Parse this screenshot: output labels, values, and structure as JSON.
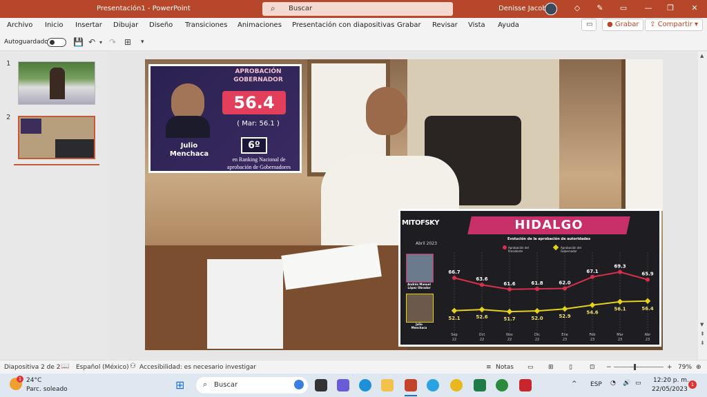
{
  "window": {
    "title": "Presentación1  -  PowerPoint",
    "search_placeholder": "Buscar",
    "user": "Denisse Jacobo"
  },
  "menu": [
    "Archivo",
    "Inicio",
    "Insertar",
    "Dibujar",
    "Diseño",
    "Transiciones",
    "Animaciones",
    "Presentación con diapositivas",
    "Grabar",
    "Revisar",
    "Vista",
    "Ayuda"
  ],
  "ribbon": {
    "record": "Grabar",
    "share": "Compartir"
  },
  "qat": {
    "autosave": "Autoguardado"
  },
  "thumbs": [
    "1",
    "2"
  ],
  "slide": {
    "card": {
      "heading_line1": "APROBACIÓN",
      "heading_line2": "GOBERNADOR",
      "value": "56.4",
      "previous": "( Mar: 56.1 )",
      "name_line1": "Julio",
      "name_line2": "Menchaca",
      "rank": "6º",
      "rank_text_line1": "en Ranking Nacional de",
      "rank_text_line2": "aprobación de Gobernadores"
    },
    "chart_card": {
      "brand": "MITOFSKY",
      "month": "Abril 2023",
      "title": "HIDALGO",
      "subtitle": "Evolución de la aprobación de autoridades",
      "legend1": "Aprobación del Presidente",
      "legend2": "Aprobación del Gobernador",
      "person1_line1": "Andrés Manuel",
      "person1_line2": "López Obrador",
      "person2_line1": "Julio",
      "person2_line2": "Menchaca"
    }
  },
  "chart_data": {
    "type": "line",
    "categories": [
      [
        "Sep",
        "22"
      ],
      [
        "Oct",
        "22"
      ],
      [
        "Nov",
        "22"
      ],
      [
        "Dic",
        "22"
      ],
      [
        "Ene",
        "23"
      ],
      [
        "Feb",
        "23"
      ],
      [
        "Mar",
        "23"
      ],
      [
        "Abr",
        "23"
      ]
    ],
    "series": [
      {
        "name": "Aprobación del Presidente",
        "values": [
          66.7,
          63.6,
          61.6,
          61.8,
          62.0,
          67.1,
          69.3,
          65.9
        ],
        "color": "#d7304d"
      },
      {
        "name": "Aprobación del Gobernador",
        "values": [
          52.1,
          52.6,
          51.7,
          52.0,
          52.9,
          54.6,
          56.1,
          56.4
        ],
        "color": "#e6d21a"
      }
    ]
  },
  "status": {
    "slide": "Diapositiva 2 de 2",
    "language": "Español (México)",
    "accessibility": "Accesibilidad: es necesario investigar",
    "notes": "Notas",
    "zoom": "79%"
  },
  "taskbar": {
    "temp": "24°C",
    "weather": "Parc. soleado",
    "search": "Buscar",
    "lang": "ESP",
    "time": "12:20 p. m.",
    "date": "22/05/2023",
    "weather_badge": "1",
    "notif_badge": "1"
  }
}
